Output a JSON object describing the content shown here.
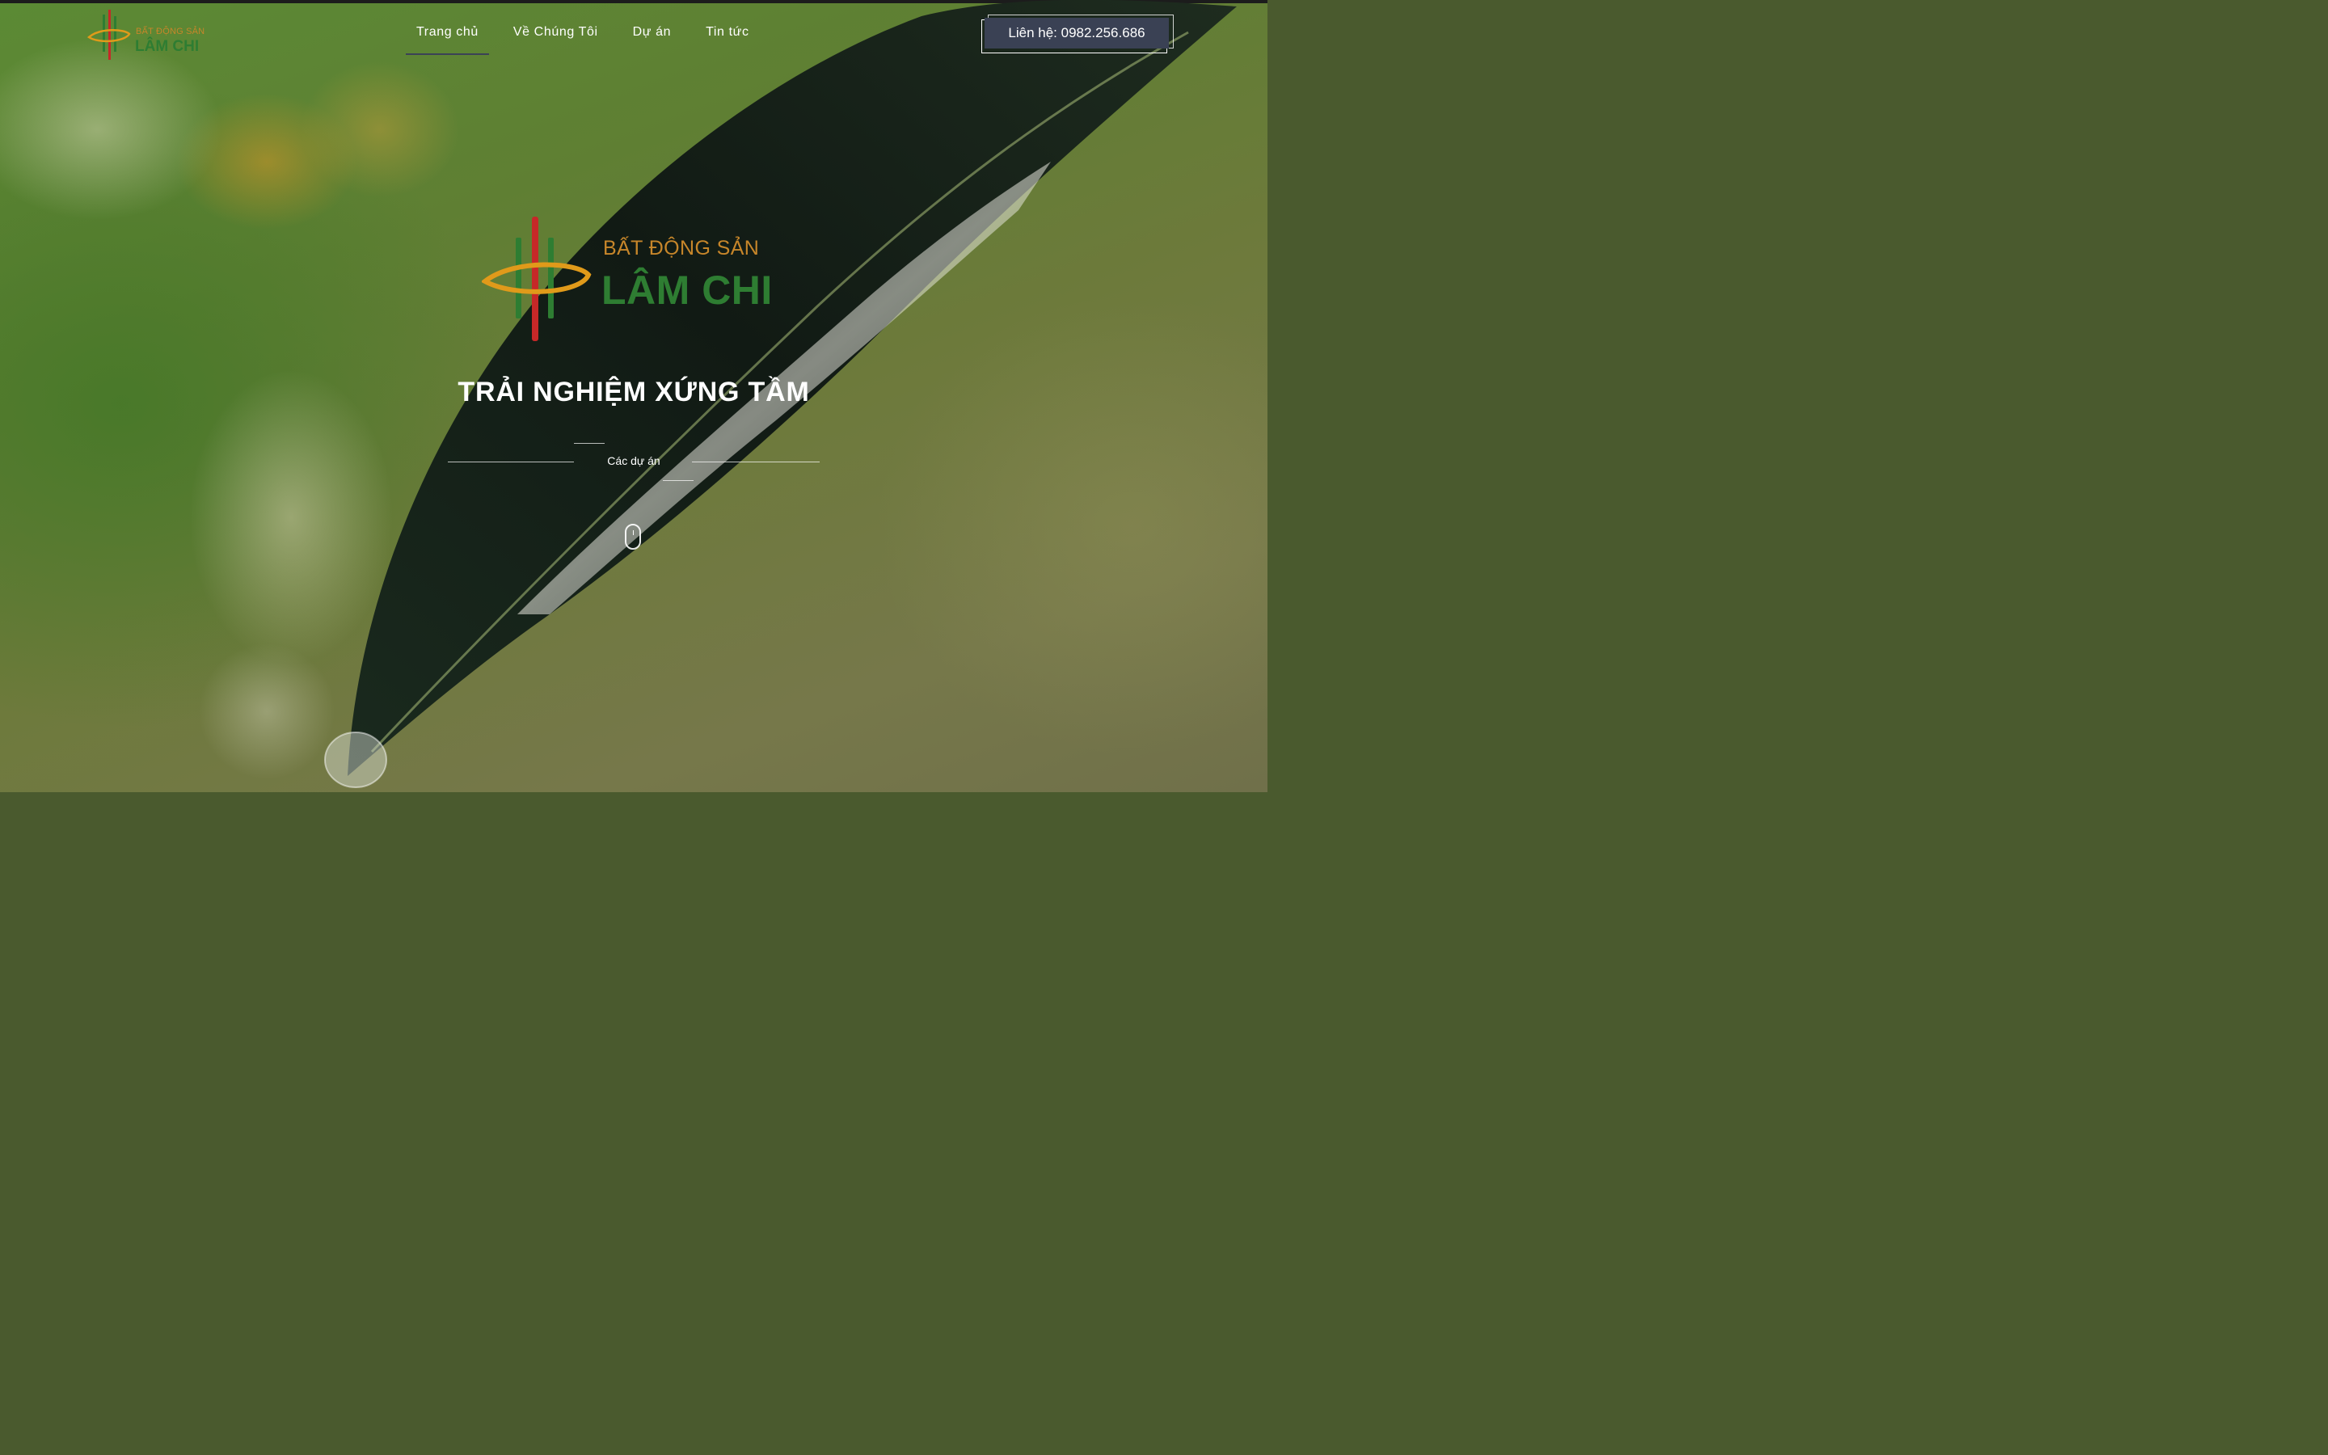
{
  "brand": {
    "tagline": "BẤT ĐỘNG SẢN",
    "name": "LÂM CHI"
  },
  "nav": {
    "items": [
      {
        "label": "Trang chủ",
        "active": true
      },
      {
        "label": "Về Chúng Tôi",
        "active": false
      },
      {
        "label": "Dự án",
        "active": false
      },
      {
        "label": "Tin tức",
        "active": false
      }
    ]
  },
  "contact": {
    "label": "Liên hệ: 0982.256.686"
  },
  "hero": {
    "headline": "TRẢI NGHIỆM XỨNG TẦM",
    "projects_link": "Các dự án",
    "scroll_icon": "mouse-scroll-icon"
  },
  "colors": {
    "logo_green": "#2e7d32",
    "logo_orange": "#c7862a",
    "logo_red": "#c62828",
    "contact_button_bg": "#3a4154"
  }
}
